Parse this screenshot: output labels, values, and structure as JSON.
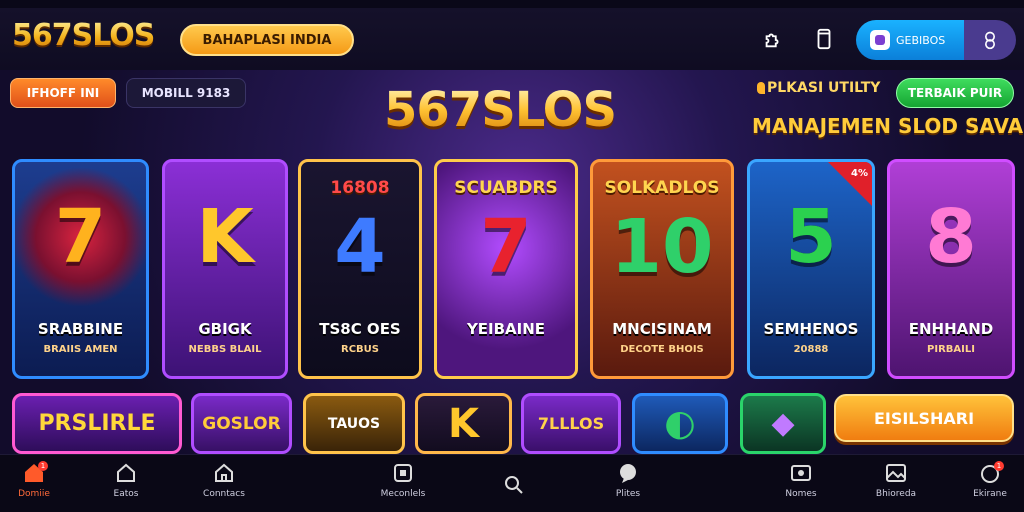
{
  "header": {
    "logo": "567SLOS",
    "promo": "BAHAPLASI INDIA",
    "icons": [
      "puzzle-icon",
      "phone-icon"
    ],
    "account_label": "GEBIBOS"
  },
  "hero": {
    "chip_orange": "IFHOFF INI",
    "chip_dark": "MOBILL 9183",
    "title": "567SLOS",
    "sub": "PLKASI UTILTY",
    "top_button": "TERBAIK PUIR",
    "tagline": "MANAJEMEN SLOD SAVA"
  },
  "cards": [
    {
      "top": "",
      "big": "7",
      "name": "SRABBINE",
      "meta": "BRAIIS AMEN",
      "badge": ""
    },
    {
      "top": "",
      "big": "K",
      "name": "GBIGK",
      "meta": "NEBBS BLAIL",
      "badge": ""
    },
    {
      "top": "16808",
      "big": "4",
      "name": "TS8C OES",
      "meta": "RCBUS",
      "badge": ""
    },
    {
      "top": "SCUABDRS",
      "big": "7",
      "name": "YEIBAINE",
      "meta": "",
      "badge": ""
    },
    {
      "top": "SOLKADLOS",
      "big": "10",
      "name": "MNCISINAM",
      "meta": "DECOTE BHOIS",
      "badge": ""
    },
    {
      "top": "",
      "big": "5",
      "name": "SEMHENOS",
      "meta": "20888",
      "badge": "4%"
    },
    {
      "top": "",
      "big": "8",
      "name": "ENHHAND",
      "meta": "PIRBAILI",
      "badge": ""
    }
  ],
  "row2": [
    {
      "text": "PRSLIRLE"
    },
    {
      "text": "GOSLOR"
    },
    {
      "text": "TAUOS"
    },
    {
      "text": "K"
    },
    {
      "text": "7LLLOS"
    },
    {
      "text": ""
    },
    {
      "text": ""
    }
  ],
  "cta": "EISILSHARI",
  "nav": [
    {
      "label": "Domiie",
      "icon": "home-icon",
      "badge": "1"
    },
    {
      "label": "Eatos",
      "icon": "house-icon",
      "badge": ""
    },
    {
      "label": "Conntacs",
      "icon": "house-outline-icon",
      "badge": ""
    },
    {
      "label": "Meconlels",
      "icon": "box-icon",
      "badge": ""
    },
    {
      "label": "",
      "icon": "search-icon",
      "badge": ""
    },
    {
      "label": "Plites",
      "icon": "chat-icon",
      "badge": ""
    },
    {
      "label": "Nomes",
      "icon": "card-icon",
      "badge": ""
    },
    {
      "label": "Bhioreda",
      "icon": "image-icon",
      "badge": ""
    },
    {
      "label": "Ekirane",
      "icon": "clock-icon",
      "badge": "1"
    }
  ]
}
